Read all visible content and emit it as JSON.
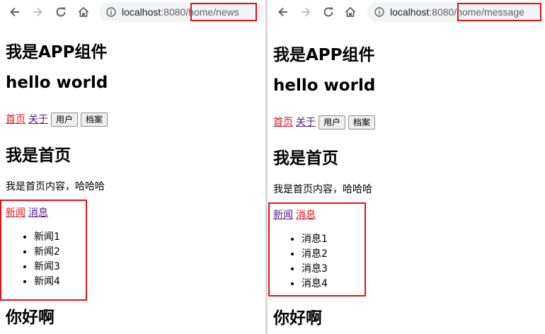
{
  "panels": [
    {
      "url": {
        "host": "localhost",
        "port": ":8080",
        "path": "/home/news"
      },
      "app_title": "我是APP组件",
      "greeting": "hello world",
      "nav_links": [
        {
          "label": "首页",
          "state": "active"
        },
        {
          "label": "关于",
          "state": "visited"
        }
      ],
      "nav_buttons": [
        "用户",
        "档案"
      ],
      "home_title": "我是首页",
      "home_text": "我是首页内容，哈哈哈",
      "sub_links": [
        {
          "label": "新闻",
          "state": "active"
        },
        {
          "label": "消息",
          "state": "visited"
        }
      ],
      "items": [
        "新闻1",
        "新闻2",
        "新闻3",
        "新闻4"
      ],
      "footer_title": "你好啊"
    },
    {
      "url": {
        "host": "localhost",
        "port": ":8080",
        "path": "/home/message"
      },
      "app_title": "我是APP组件",
      "greeting": "hello world",
      "nav_links": [
        {
          "label": "首页",
          "state": "active"
        },
        {
          "label": "关于",
          "state": "visited"
        }
      ],
      "nav_buttons": [
        "用户",
        "档案"
      ],
      "home_title": "我是首页",
      "home_text": "我是首页内容，哈哈哈",
      "sub_links": [
        {
          "label": "新闻",
          "state": "visited"
        },
        {
          "label": "消息",
          "state": "active"
        }
      ],
      "items": [
        "消息1",
        "消息2",
        "消息3",
        "消息4"
      ],
      "footer_title": "你好啊"
    }
  ],
  "colors": {
    "active_link": "#e0141e",
    "visited_link": "#551a8b",
    "highlight_box": "#e0141e",
    "omnibox_bg": "#f1f3f4"
  },
  "icons": [
    "back-arrow-icon",
    "forward-arrow-icon",
    "reload-icon",
    "home-icon",
    "info-icon"
  ]
}
